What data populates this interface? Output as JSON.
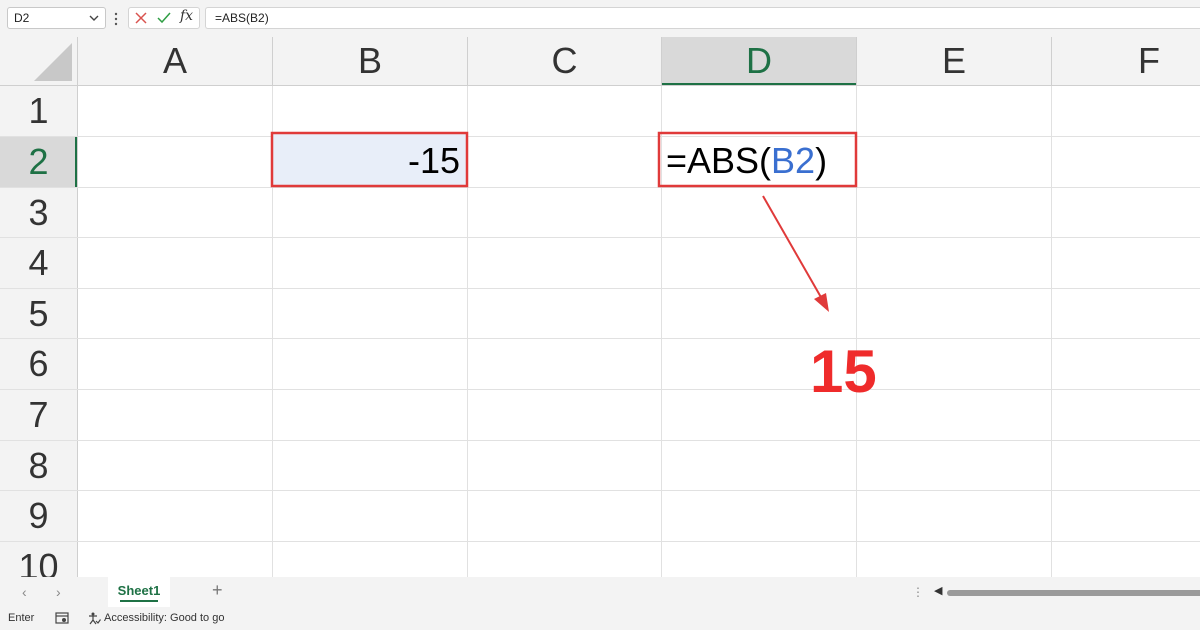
{
  "formula_bar": {
    "name_box": "D2",
    "formula": "=ABS(B2)",
    "fx_label": "fx"
  },
  "columns": [
    "A",
    "B",
    "C",
    "D",
    "E",
    "F"
  ],
  "rows": [
    "1",
    "2",
    "3",
    "4",
    "5",
    "6",
    "7",
    "8",
    "9",
    "10"
  ],
  "selected_column": "D",
  "selected_row": "2",
  "cells": {
    "B2": "-15",
    "D2": {
      "prefix": "=ABS(",
      "ref": "B2",
      "suffix": ")"
    }
  },
  "annotation": {
    "result": "15",
    "color": "#ef2b2b"
  },
  "sheet_tabs": {
    "active": "Sheet1",
    "add_label": "+"
  },
  "status_bar": {
    "mode": "Enter",
    "accessibility": "Accessibility: Good to go"
  },
  "colors": {
    "selected_header": "#1e7145",
    "highlight_fill": "#e8eef9",
    "cell_ref": "#3a6fd0"
  }
}
